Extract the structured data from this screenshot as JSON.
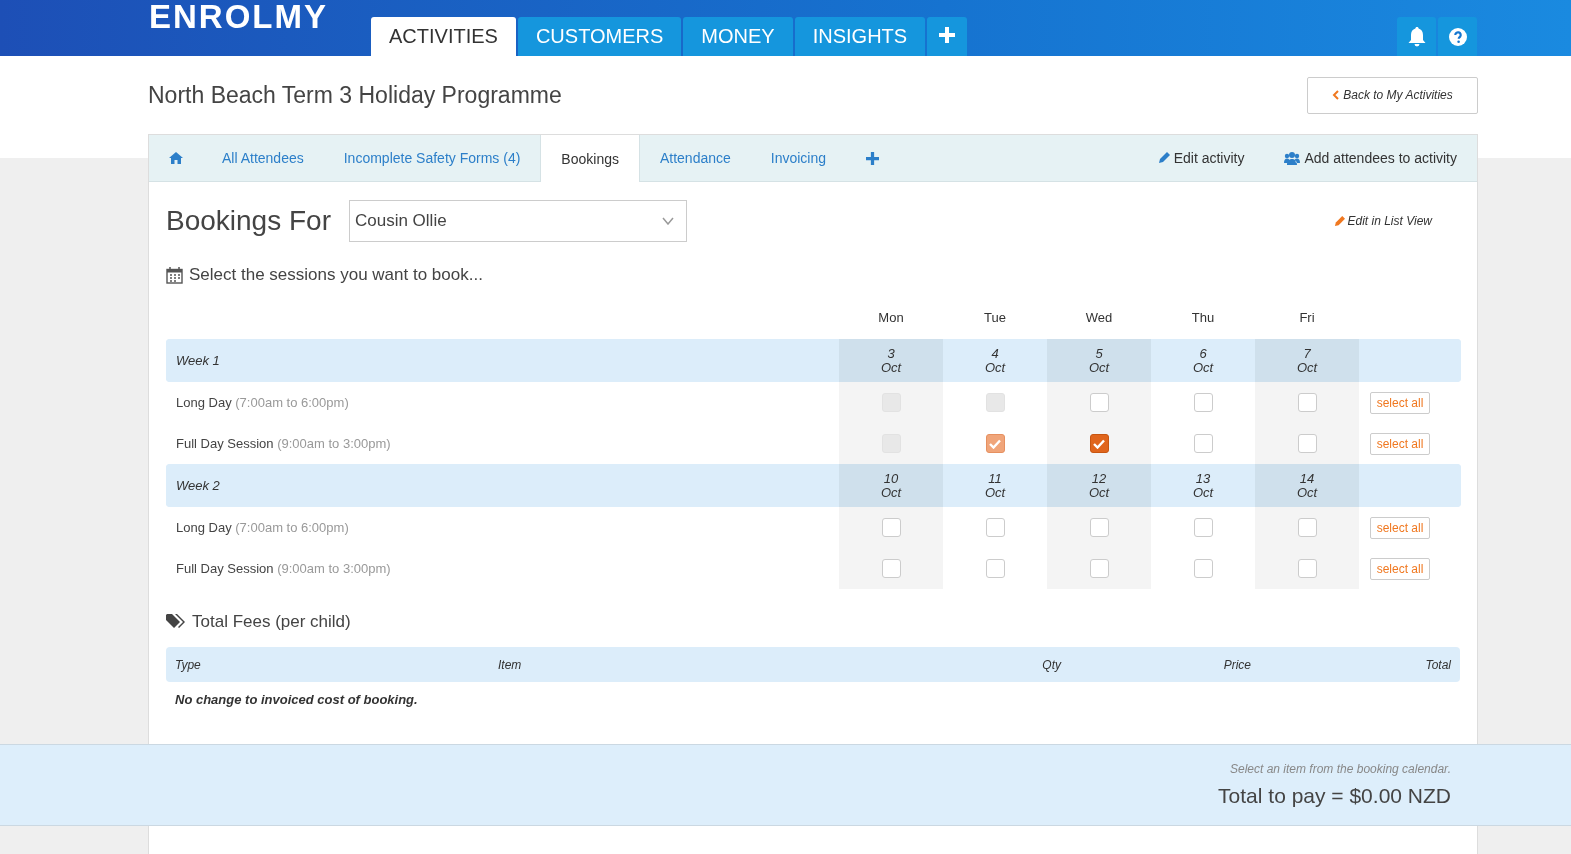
{
  "header": {
    "logo": "ENROLMY",
    "nav": [
      {
        "label": "ACTIVITIES",
        "selected": true
      },
      {
        "label": "CUSTOMERS",
        "selected": false
      },
      {
        "label": "MONEY",
        "selected": false
      },
      {
        "label": "INSIGHTS",
        "selected": false
      }
    ]
  },
  "page": {
    "title": "North Beach Term 3 Holiday Programme",
    "back_button": "Back to My Activities"
  },
  "tabs": [
    {
      "label": "All Attendees",
      "selected": false
    },
    {
      "label": "Incomplete Safety Forms (4)",
      "selected": false
    },
    {
      "label": "Bookings",
      "selected": true
    },
    {
      "label": "Attendance",
      "selected": false
    },
    {
      "label": "Invoicing",
      "selected": false
    }
  ],
  "actions": [
    "Edit activity",
    "Add attendees to activity"
  ],
  "bookings": {
    "heading": "Bookings For",
    "attendee": "Cousin Ollie",
    "edit_link": "Edit in List View",
    "prompt": "Select the sessions you want to book...",
    "days": [
      "Mon",
      "Tue",
      "Wed",
      "Thu",
      "Fri"
    ],
    "weeks": [
      {
        "label": "Week 1",
        "dates": [
          {
            "day": "3",
            "month": "Oct"
          },
          {
            "day": "4",
            "month": "Oct"
          },
          {
            "day": "5",
            "month": "Oct"
          },
          {
            "day": "6",
            "month": "Oct"
          },
          {
            "day": "7",
            "month": "Oct"
          }
        ],
        "sessions": [
          {
            "name": "Long Day",
            "hours": "(7:00am to 6:00pm)",
            "select_all": "select all",
            "slots": [
              {
                "kind": "unavailable",
                "checked": false
              },
              {
                "kind": "unavailable",
                "checked": false
              },
              {
                "kind": "open",
                "checked": false
              },
              {
                "kind": "open",
                "checked": false
              },
              {
                "kind": "open",
                "checked": false
              }
            ]
          },
          {
            "name": "Full Day Session",
            "hours": "(9:00am to 3:00pm)",
            "select_all": "select all",
            "slots": [
              {
                "kind": "unavailable",
                "checked": false
              },
              {
                "kind": "booked",
                "checked": true
              },
              {
                "kind": "open",
                "checked": true
              },
              {
                "kind": "open",
                "checked": false
              },
              {
                "kind": "open",
                "checked": false
              }
            ]
          }
        ]
      },
      {
        "label": "Week 2",
        "dates": [
          {
            "day": "10",
            "month": "Oct"
          },
          {
            "day": "11",
            "month": "Oct"
          },
          {
            "day": "12",
            "month": "Oct"
          },
          {
            "day": "13",
            "month": "Oct"
          },
          {
            "day": "14",
            "month": "Oct"
          }
        ],
        "sessions": [
          {
            "name": "Long Day",
            "hours": "(7:00am to 6:00pm)",
            "select_all": "select all",
            "slots": [
              {
                "kind": "open",
                "checked": false
              },
              {
                "kind": "open",
                "checked": false
              },
              {
                "kind": "open",
                "checked": false
              },
              {
                "kind": "open",
                "checked": false
              },
              {
                "kind": "open",
                "checked": false
              }
            ]
          },
          {
            "name": "Full Day Session",
            "hours": "(9:00am to 3:00pm)",
            "select_all": "select all",
            "slots": [
              {
                "kind": "open",
                "checked": false
              },
              {
                "kind": "open",
                "checked": false
              },
              {
                "kind": "open",
                "checked": false
              },
              {
                "kind": "open",
                "checked": false
              },
              {
                "kind": "open",
                "checked": false
              }
            ]
          }
        ]
      }
    ]
  },
  "fees": {
    "heading": "Total Fees (per child)",
    "columns": [
      "Type",
      "Item",
      "Qty",
      "Price",
      "Total"
    ],
    "empty": "No change to invoiced cost of booking."
  },
  "footer": {
    "hint": "Select an item from the booking calendar.",
    "total": "Total to pay = $0.00 NZD"
  }
}
